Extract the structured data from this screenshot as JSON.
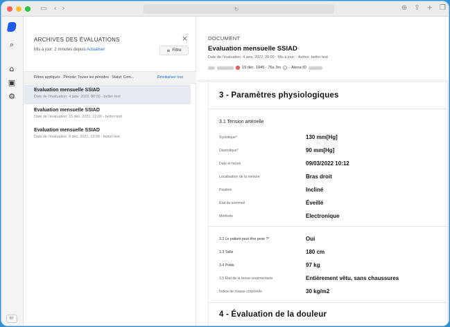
{
  "browser": {
    "url": "",
    "reload_icon": "reload-icon"
  },
  "rail": {
    "initials": "BT"
  },
  "left_panel": {
    "title": "ARCHIVES DES ÉVALUATIONS",
    "update_text": "Mis à jour: 2 minutes depuis",
    "update_link": "Actualiser",
    "filter_button": "Filtre",
    "filters_text": "Filtres appliqués · Période: Toutes les périodes · Statut: Com...",
    "reset_link": "Réinitialiser tout",
    "items": [
      {
        "title": "Evaluation mensuelle SSIAD",
        "subtitle": "Date de l'évaluation: 4 janv. 2022, 00:00 - better-test"
      },
      {
        "title": "Evaluation mensuelle SSIAD",
        "subtitle": "Date de l'évaluation: 15 déc. 2021, 12:00 - better-test"
      },
      {
        "title": "Evaluation mensuelle SSIAD",
        "subtitle": "Date de l'évaluation: 8 déc. 2021, 13:00 - better-test"
      }
    ]
  },
  "document": {
    "label": "DOCUMENT",
    "title": "Evaluation mensuelle SSIAD",
    "meta": "Date de l'évaluation: 4 janv. 2022, 00:00 · Mis à jour: · Author: better-test",
    "patient_dob": "19 déc. 1945 · 76a 3m",
    "patient_id_label": "· Atena ID",
    "section3_title": "3 - Paramètres physiologiques",
    "subsection_title": "3.1 Tension artérielle",
    "rows_a": [
      {
        "label": "Systolique*",
        "value": "130 mm[Hg]"
      },
      {
        "label": "Diastolique*",
        "value": "90 mm[Hg]"
      },
      {
        "label": "Date et heure",
        "value": "09/03/2022 10:12"
      },
      {
        "label": "Localisation de la mesure",
        "value": "Bras droit"
      },
      {
        "label": "Position",
        "value": "Incliné"
      },
      {
        "label": "État du sommeil",
        "value": "Éveillé"
      },
      {
        "label": "Méthode",
        "value": "Electronique"
      }
    ],
    "rows_b": [
      {
        "label": "3.2 Le patient peut être pesé ?*",
        "value": "Oui"
      },
      {
        "label": "3.3 Taille",
        "value": "180 cm"
      },
      {
        "label": "3.4 Poids",
        "value": "97 kg"
      },
      {
        "label": "3.5 État de la tenue vestimentaire",
        "value": "Entièrement vêtu, sans chaussures"
      },
      {
        "label": "Indice de masse corporelle",
        "value": "30 kg/m2"
      }
    ],
    "section4_title": "4 - Évaluation de la douleur"
  }
}
